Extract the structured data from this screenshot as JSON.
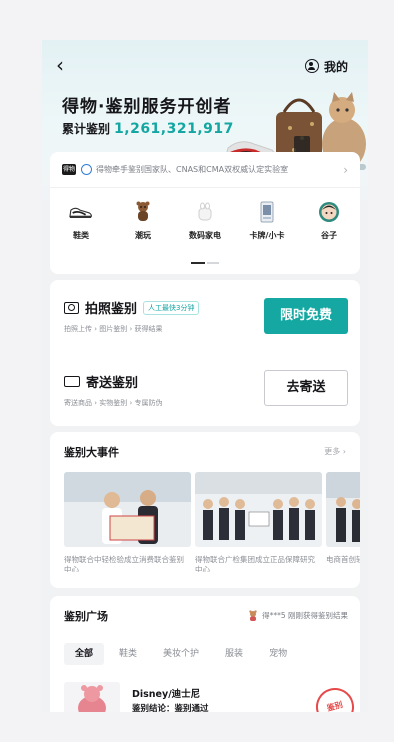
{
  "header": {
    "back_glyph": "‹",
    "mine_label": "我的",
    "mine_icon": "user-icon"
  },
  "hero": {
    "title": "得物·鉴别服务开创者",
    "count_label": "累计鉴别",
    "count_value": "1,261,321,917"
  },
  "banner": {
    "icon_text": "得物",
    "text": "得物牵手鉴别国家队、CNAS和CMA双权威认定实验室",
    "chevron": "›"
  },
  "categories": [
    {
      "label": "鞋类",
      "icon": "sneaker-icon"
    },
    {
      "label": "潮玩",
      "icon": "bear-toy-icon"
    },
    {
      "label": "数码家电",
      "icon": "earbuds-icon"
    },
    {
      "label": "卡牌/小卡",
      "icon": "card-icon"
    },
    {
      "label": "谷子",
      "icon": "badge-icon"
    }
  ],
  "photo_auth": {
    "title": "拍照鉴别",
    "tag": "人工最快3分钟",
    "sub": "拍照上传 › 图片鉴别 › 获得结果",
    "button": "限时免费"
  },
  "mail_auth": {
    "title": "寄送鉴别",
    "sub": "寄送商品 › 实物鉴别 › 专属防伪",
    "button": "去寄送"
  },
  "events": {
    "title": "鉴别大事件",
    "more": "更多 ›",
    "items": [
      {
        "caption": "得物联合中轻检验成立消费联合鉴别中心"
      },
      {
        "caption": "得物联合广检集团成立正品保障研究中心"
      },
      {
        "caption": "电商首创轻奢防伪权威"
      }
    ]
  },
  "feed": {
    "title": "鉴别广场",
    "latest": "得***5 刚刚获得鉴别结果",
    "tabs": [
      "全部",
      "鞋类",
      "美妆个护",
      "服装",
      "宠物"
    ],
    "active_tab": "全部",
    "item": {
      "name": "Disney/迪士尼",
      "result": "鉴别结论：鉴别通过",
      "stamp": "鉴别"
    }
  },
  "colors": {
    "accent": "#15a8a2",
    "count": "#13a6a2",
    "stamp": "#e64a4a"
  }
}
